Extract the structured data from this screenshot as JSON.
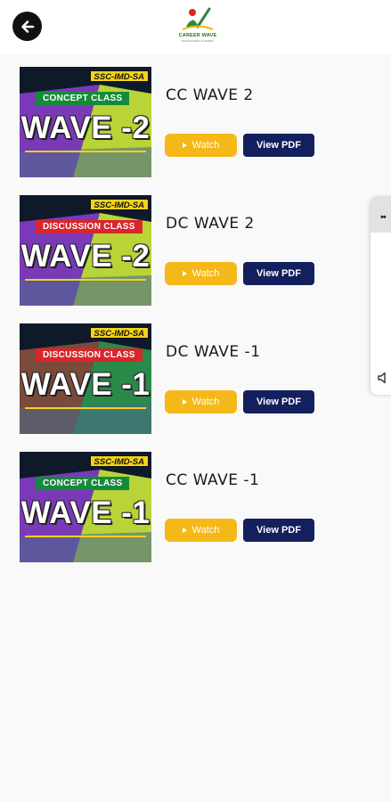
{
  "header": {
    "back_icon": "arrow-left-icon",
    "logo": {
      "text": "CAREER WAVE",
      "subtext": "EDUCATIONAL ACADEMY"
    }
  },
  "videos": [
    {
      "tag": "SSC-IMD-SA",
      "class_label": "CONCEPT CLASS",
      "class_color": "#168a3c",
      "wave": "WAVE -2",
      "title": "CC WAVE 2",
      "watch_label": "Watch",
      "pdf_label": "View PDF"
    },
    {
      "tag": "SSC-IMD-SA",
      "class_label": "DISCUSSION CLASS",
      "class_color": "#d8262c",
      "wave": "WAVE -2",
      "title": "DC WAVE 2",
      "watch_label": "Watch",
      "pdf_label": "View PDF"
    },
    {
      "tag": "SSC-IMD-SA",
      "class_label": "DISCUSSION CLASS",
      "class_color": "#d8262c",
      "wave": "WAVE -1",
      "title": "DC WAVE -1",
      "watch_label": "Watch",
      "pdf_label": "View PDF"
    },
    {
      "tag": "SSC-IMD-SA",
      "class_label": "CONCEPT CLASS",
      "class_color": "#168a3c",
      "wave": "WAVE -1",
      "title": "CC WAVE -1",
      "watch_label": "Watch",
      "pdf_label": "View PDF"
    }
  ],
  "side_panel": {
    "menu_icon": "more-dots-icon",
    "sound_icon": "speaker-icon"
  },
  "colors": {
    "watch": "#f5b819",
    "pdf": "#141f5e",
    "tag": "#f2d21a"
  }
}
